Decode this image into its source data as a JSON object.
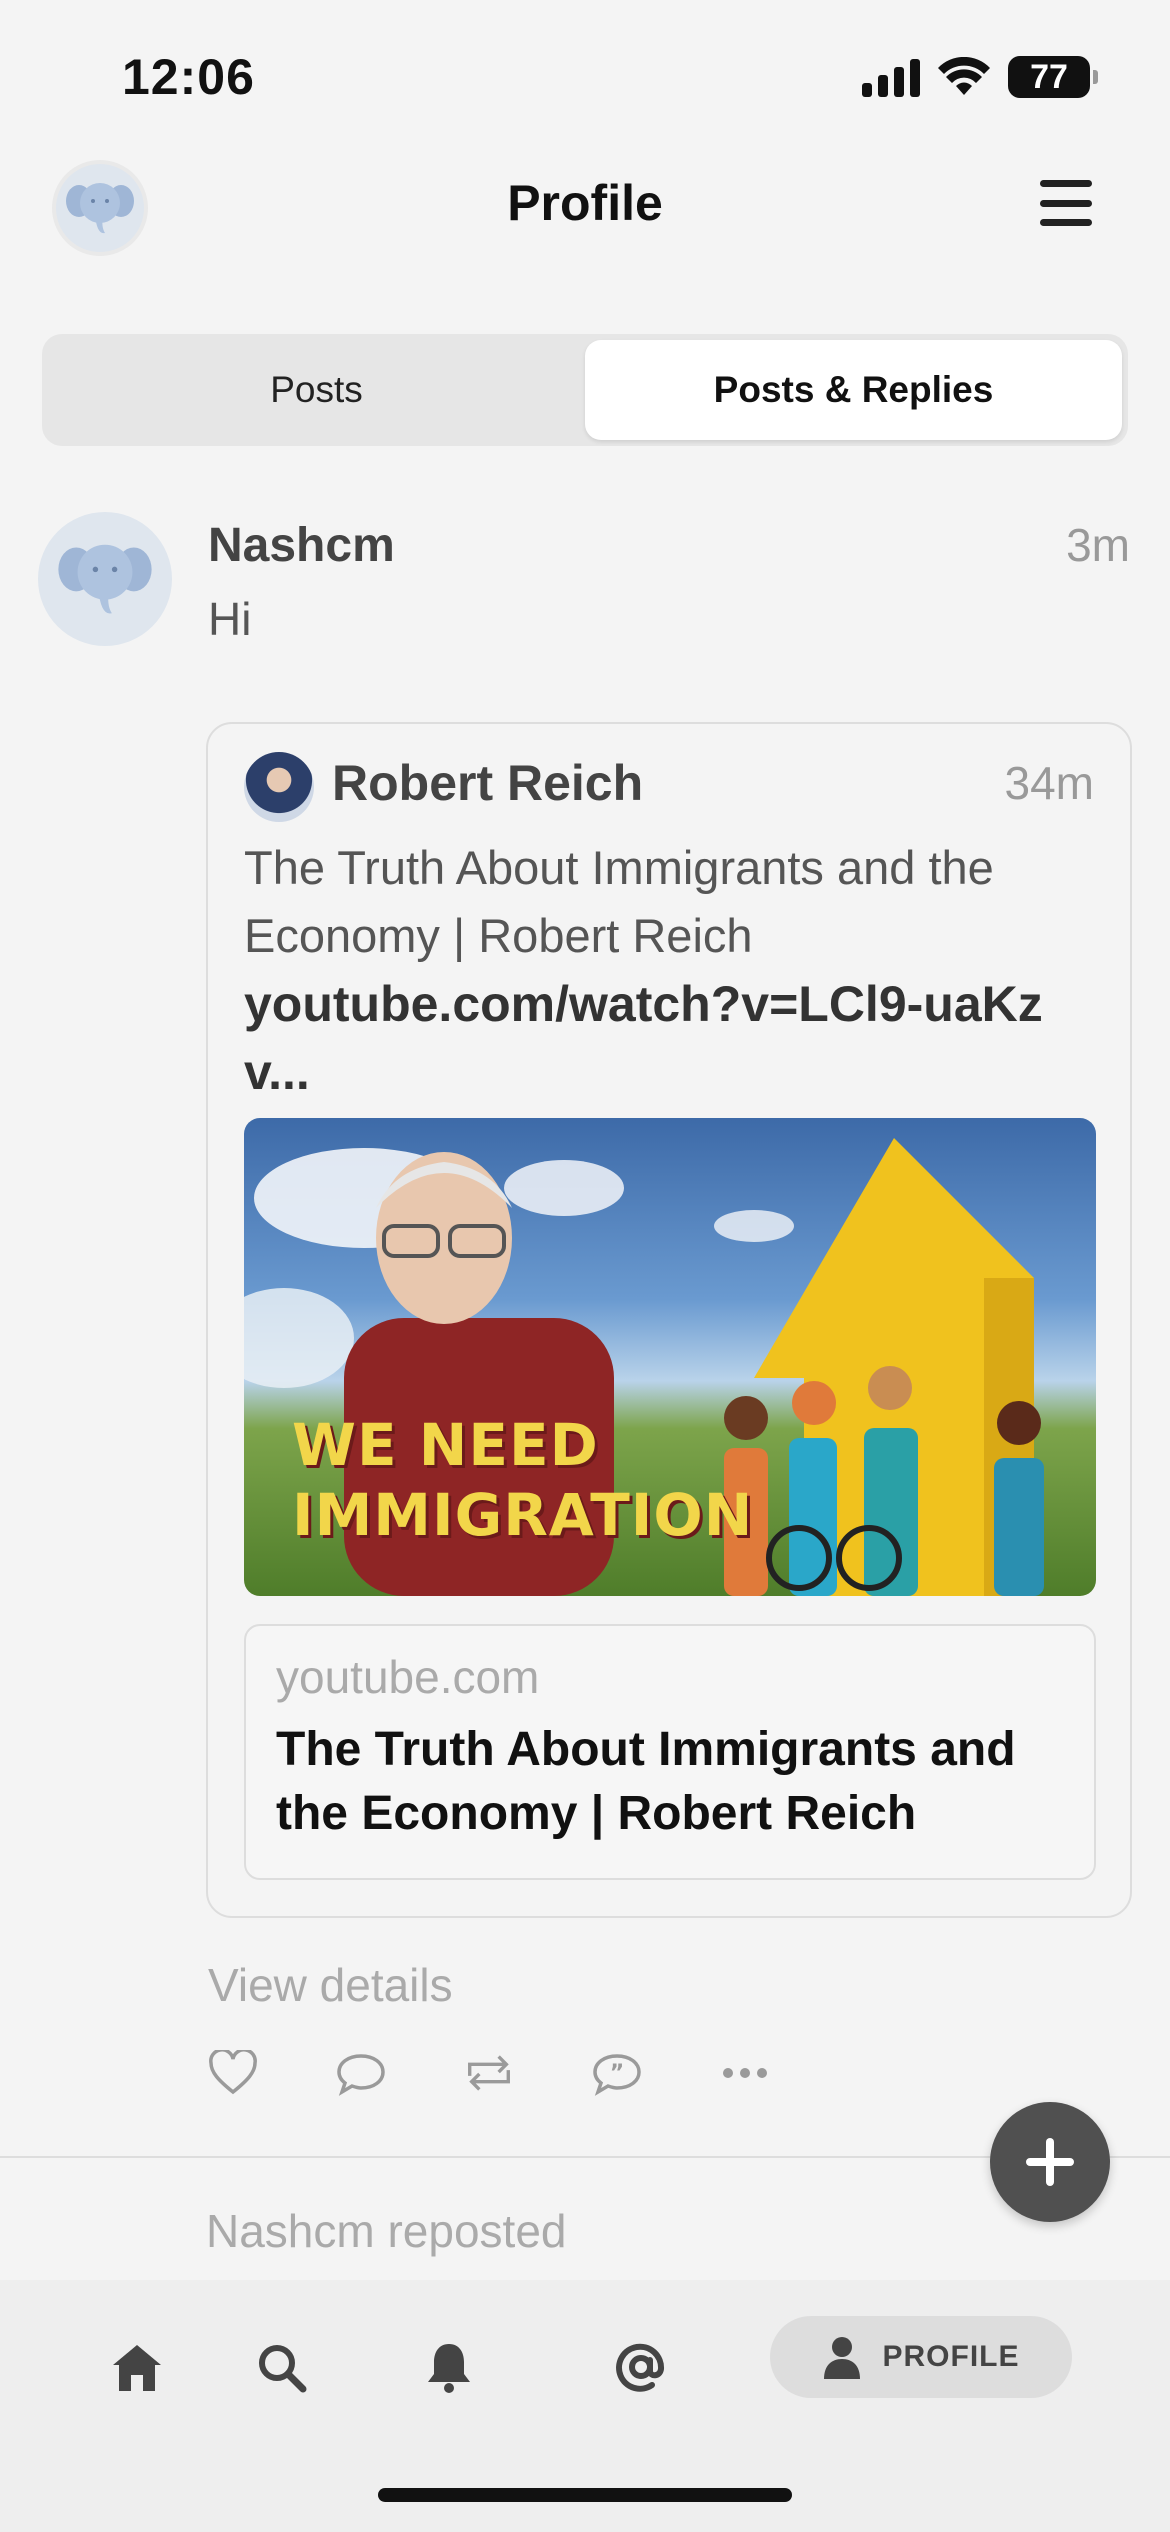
{
  "status_bar": {
    "time": "12:06",
    "battery": "77"
  },
  "header": {
    "title": "Profile"
  },
  "tabs": [
    {
      "label": "Posts",
      "active": false
    },
    {
      "label": "Posts & Replies",
      "active": true
    }
  ],
  "post": {
    "author": "Nashcm",
    "time": "3m",
    "text": "Hi",
    "quote": {
      "author": "Robert Reich",
      "time": "34m",
      "text": "The Truth About Immigrants and the Economy | Robert Reich",
      "link": "youtube.com/watch?v=LCl9-uaKzv...",
      "media_caption": "WE NEED IMMIGRATION",
      "link_card": {
        "domain": "youtube.com",
        "title": "The Truth About Immigrants and the Economy | Robert Reich"
      }
    },
    "view_details": "View details",
    "actions": [
      "heart-icon",
      "comment-icon",
      "repost-icon",
      "quote-icon",
      "more-icon"
    ]
  },
  "next_post": {
    "repost_label": "Nashcm reposted"
  },
  "bottom_nav": {
    "items": [
      "home-icon",
      "search-icon",
      "bell-icon",
      "mention-icon"
    ],
    "profile_label": "PROFILE"
  },
  "colors": {
    "accent": "#505050",
    "background": "#f4f4f4",
    "muted": "#aaaaaa"
  }
}
